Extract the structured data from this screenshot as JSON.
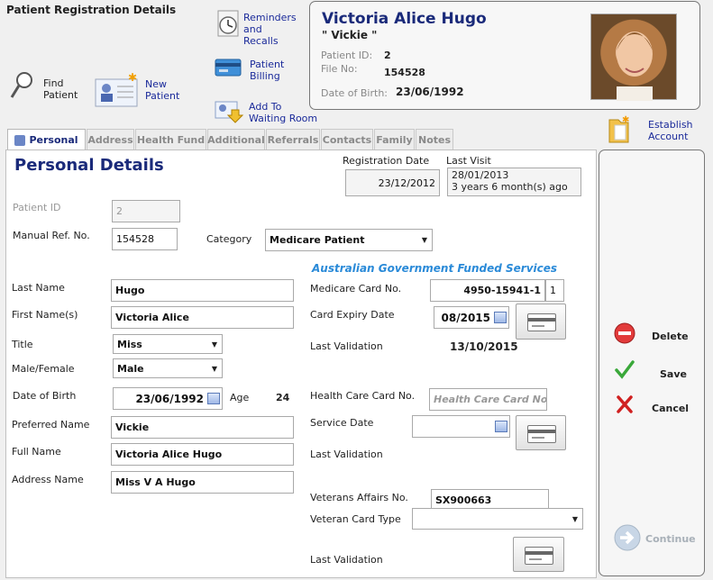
{
  "app_title": "Patient Registration Details",
  "toolbar": {
    "find_patient": "Find\nPatient",
    "new_patient": "New\nPatient",
    "reminders": "Reminders\nand\nRecalls",
    "billing": "Patient\nBilling",
    "waiting_room": "Add To\nWaiting Room",
    "establish_account": "Establish\nAccount"
  },
  "patient_card": {
    "name": "Victoria Alice Hugo",
    "nickname": "\" Vickie \"",
    "patient_id_label": "Patient ID:",
    "patient_id": "2",
    "file_no_label": "File No:",
    "file_no": "154528",
    "dob_label": "Date of Birth:",
    "dob": "23/06/1992"
  },
  "tabs": [
    "Personal",
    "Address",
    "Health Fund",
    "Additional",
    "Referrals",
    "Contacts",
    "Family",
    "Notes"
  ],
  "form": {
    "section_title": "Personal Details",
    "registration_date_label": "Registration Date",
    "registration_date": "23/12/2012",
    "last_visit_label": "Last Visit",
    "last_visit_date": "28/01/2013",
    "last_visit_ago": "3 years 6 month(s) ago",
    "patient_id_label": "Patient ID",
    "patient_id": "2",
    "manual_ref_label": "Manual Ref. No.",
    "manual_ref": "154528",
    "category_label": "Category",
    "category": "Medicare Patient",
    "last_name_label": "Last Name",
    "last_name": "Hugo",
    "first_name_label": "First Name(s)",
    "first_name": "Victoria Alice",
    "title_label": "Title",
    "title": "Miss",
    "sex_label": "Male/Female",
    "sex": "Male",
    "dob_label": "Date of Birth",
    "dob": "23/06/1992",
    "age_label": "Age",
    "age": "24",
    "preferred_name_label": "Preferred Name",
    "preferred_name": "Vickie",
    "full_name_label": "Full Name",
    "full_name": "Victoria Alice Hugo",
    "address_name_label": "Address Name",
    "address_name": "Miss V A Hugo",
    "govt_heading": "Australian Government Funded Services",
    "medicare_label": "Medicare Card No.",
    "medicare_no": "4950-15941-1",
    "medicare_irn": "1",
    "card_expiry_label": "Card Expiry Date",
    "card_expiry": "08/2015",
    "last_validation_label": "Last Validation",
    "medicare_last_validation": "13/10/2015",
    "health_care_label": "Health Care Card No.",
    "health_care_placeholder": "Health Care Card No",
    "service_date_label": "Service Date",
    "veterans_label": "Veterans Affairs No.",
    "veterans_no": "SX900663",
    "veteran_card_type_label": "Veteran Card Type",
    "veteran_card_type": ""
  },
  "actions": {
    "delete": "Delete",
    "save": "Save",
    "cancel": "Cancel",
    "continue": "Continue"
  }
}
